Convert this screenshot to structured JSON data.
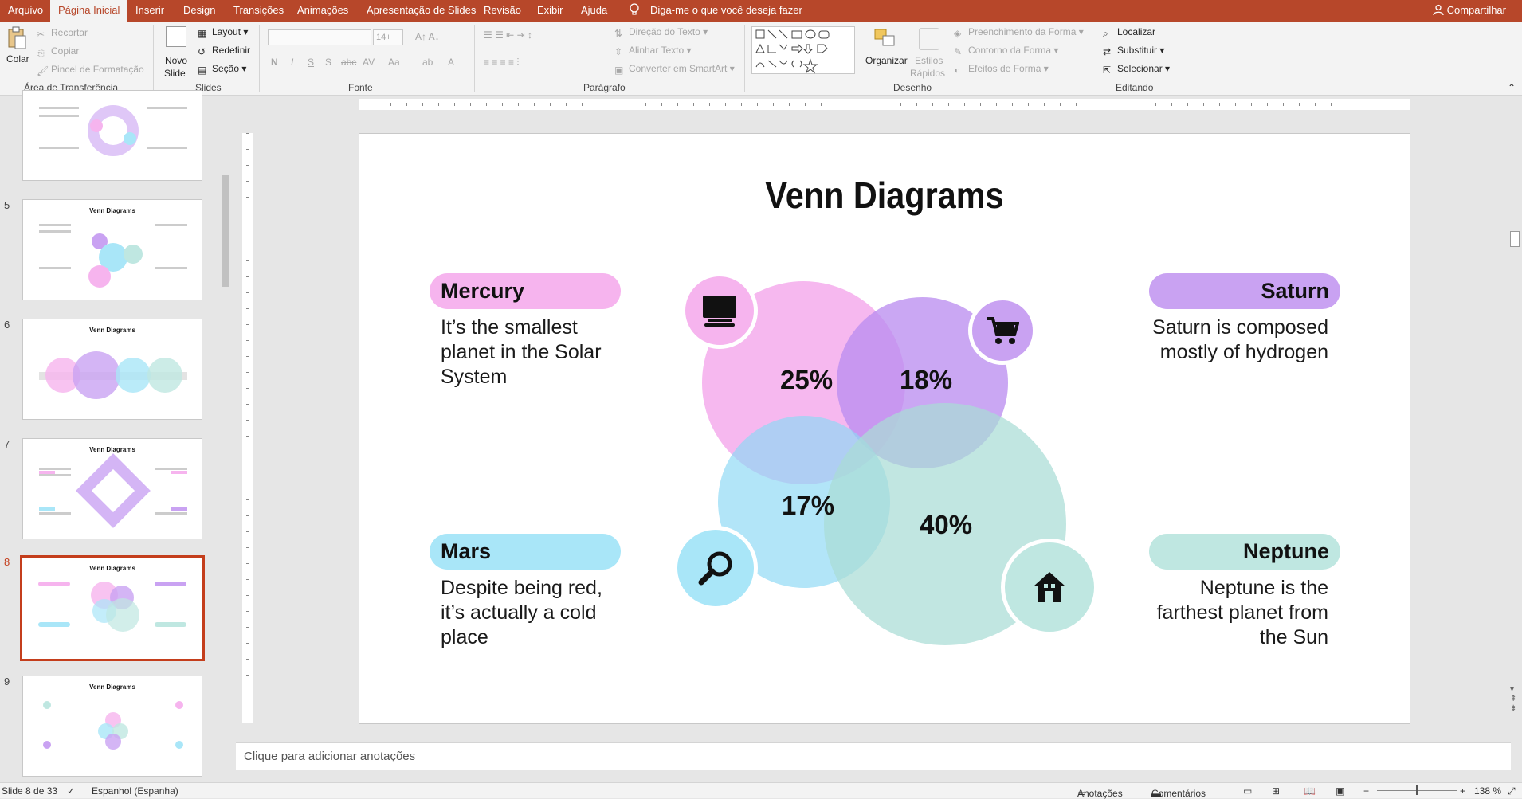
{
  "menu": {
    "tabs": [
      "Arquivo",
      "Página Inicial",
      "Inserir",
      "Design",
      "Transições",
      "Animações",
      "Apresentação de Slides",
      "Revisão",
      "Exibir",
      "Ajuda"
    ],
    "active_tab": "Página Inicial",
    "tell_me": "Diga-me o que você deseja fazer",
    "share": "Compartilhar",
    "bar_color": "#b7472a"
  },
  "ribbon": {
    "clipboard": {
      "paste": "Colar",
      "cut": "Recortar",
      "copy": "Copiar",
      "format_painter": "Pincel de Formatação",
      "label": "Área de Transferência"
    },
    "slides": {
      "new_slide_line1": "Novo",
      "new_slide_line2": "Slide",
      "layout": "Layout",
      "reset": "Redefinir",
      "section": "Seção",
      "label": "Slides"
    },
    "font": {
      "label": "Fonte",
      "size": "14+"
    },
    "paragraph": {
      "text_direction": "Direção do Texto",
      "align_text": "Alinhar Texto",
      "convert_smartart": "Converter em SmartArt",
      "label": "Parágrafo"
    },
    "drawing": {
      "arrange": "Organizar",
      "quick_styles_line1": "Estilos",
      "quick_styles_line2": "Rápidos",
      "shape_fill": "Preenchimento da Forma",
      "shape_outline": "Contorno da Forma",
      "shape_effects": "Efeitos de Forma",
      "label": "Desenho"
    },
    "editing": {
      "find": "Localizar",
      "replace": "Substituir",
      "select": "Selecionar",
      "label": "Editando"
    }
  },
  "thumbnails": [
    {
      "number": "",
      "title": ""
    },
    {
      "number": "5",
      "title": "Venn Diagrams"
    },
    {
      "number": "6",
      "title": "Venn Diagrams"
    },
    {
      "number": "7",
      "title": "Venn Diagrams"
    },
    {
      "number": "8",
      "title": "Venn Diagrams"
    },
    {
      "number": "9",
      "title": "Venn Diagrams"
    }
  ],
  "slide": {
    "title": "Venn Diagrams",
    "mercury": {
      "label": "Mercury",
      "desc": "It’s the smallest planet in the Solar System",
      "color": "#f6b4ee"
    },
    "saturn": {
      "label": "Saturn",
      "desc": "Saturn is composed mostly of hydrogen",
      "color": "#c9a2f2"
    },
    "mars": {
      "label": "Mars",
      "desc": "Despite being red, it’s actually a cold place",
      "color": "#a9e6f8"
    },
    "neptune": {
      "label": "Neptune",
      "desc": "Neptune is the farthest planet from the Sun",
      "color": "#bfe7e1"
    },
    "percentages": {
      "mercury": "25%",
      "saturn": "18%",
      "mars": "17%",
      "neptune": "40%"
    },
    "icons": [
      "monitor-icon",
      "shopping-cart-icon",
      "magnifier-icon",
      "house-icon"
    ]
  },
  "notes_placeholder": "Clique para adicionar anotações",
  "status": {
    "slide_count": "Slide 8 de 33",
    "language": "Espanhol (Espanha)",
    "notes": "Anotações",
    "comments": "Comentários",
    "zoom": "138 %"
  }
}
